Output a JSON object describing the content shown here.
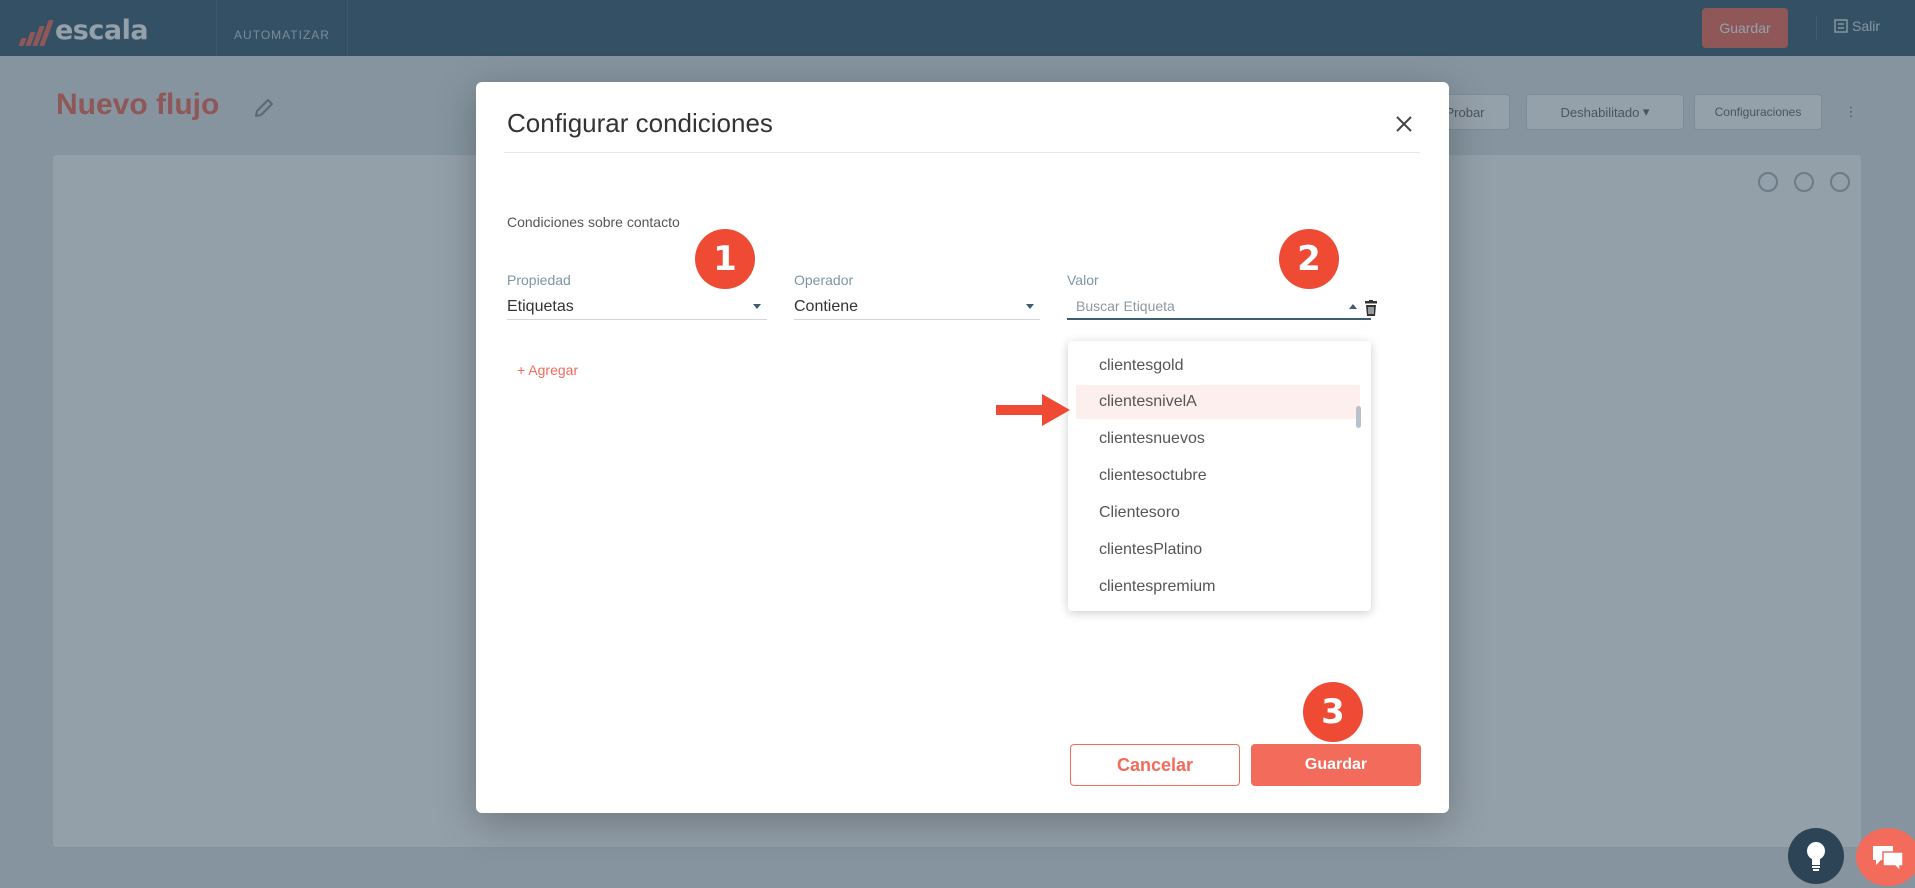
{
  "app": {
    "logo_text": "escala",
    "nav_tab": "AUTOMATIZAR",
    "save_label": "Guardar",
    "exit_label": "Salir"
  },
  "page": {
    "title": "Nuevo flujo",
    "toolbar": {
      "test_label": "Probar",
      "status_label": "Deshabilitado",
      "settings_label": "Configuraciones"
    }
  },
  "modal": {
    "title": "Configurar condiciones",
    "section_label": "Condiciones sobre contacto",
    "property": {
      "label": "Propiedad",
      "value": "Etiquetas"
    },
    "operator": {
      "label": "Operador",
      "value": "Contiene"
    },
    "value": {
      "label": "Valor",
      "placeholder": "Buscar Etiqueta"
    },
    "add_label": "+ Agregar",
    "dropdown": {
      "items": [
        "clientesgold",
        "clientesnivelA",
        "clientesnuevos",
        "clientesoctubre",
        "Clientesoro",
        "clientesPlatino",
        "clientespremium"
      ],
      "selected_index": 1
    },
    "cancel_label": "Cancelar",
    "save_label": "Guardar"
  },
  "annotations": {
    "step1": "1",
    "step2": "2",
    "step3": "3"
  },
  "colors": {
    "accent": "#f26b5b",
    "header": "#3d5d73",
    "badge": "#ef4a34"
  },
  "icons": [
    "edit-icon",
    "close-icon",
    "chevron-down-icon",
    "chevron-up-icon",
    "trash-icon",
    "arrow-right-icon",
    "lightbulb-icon",
    "chat-icon",
    "menu-icon",
    "kebab-icon",
    "search-icon",
    "user-icon"
  ]
}
